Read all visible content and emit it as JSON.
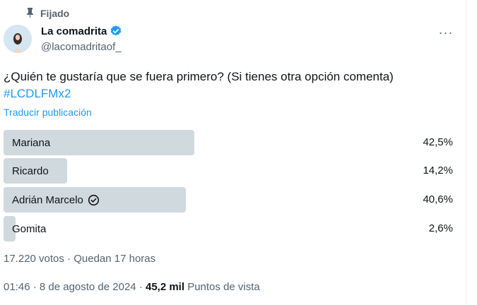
{
  "pinned": {
    "label": "Fijado"
  },
  "author": {
    "name": "La comadrita",
    "handle": "@lacomadritaof_"
  },
  "tweet": {
    "text_line1": "¿Quién te gustaría que se fuera primero? (Si tienes otra opción comenta)",
    "hashtag": "#LCDLFMx2",
    "translate_label": "Traducir publicación"
  },
  "poll": {
    "options": [
      {
        "label": "Mariana",
        "percent_text": "42,5%",
        "percent": 42.5,
        "selected": false
      },
      {
        "label": "Ricardo",
        "percent_text": "14,2%",
        "percent": 14.2,
        "selected": false
      },
      {
        "label": "Adrián Marcelo",
        "percent_text": "40,6%",
        "percent": 40.6,
        "selected": true
      },
      {
        "label": "Gomita",
        "percent_text": "2,6%",
        "percent": 2.6,
        "selected": false
      }
    ],
    "meta": "17.220 votos · Quedan 17 horas"
  },
  "timestamp": {
    "time_date": "01:46 · 8 de agosto de 2024 · ",
    "views_count": "45,2 mil",
    "views_label": " Puntos de vista"
  },
  "colors": {
    "accent": "#1d9bf0",
    "bar": "#cfd9de",
    "muted": "#536471",
    "text": "#0f1419"
  },
  "icons": {
    "pin": "pin-icon",
    "verified": "verified-badge-icon",
    "more": "more-icon",
    "selected": "check-circle-icon"
  }
}
